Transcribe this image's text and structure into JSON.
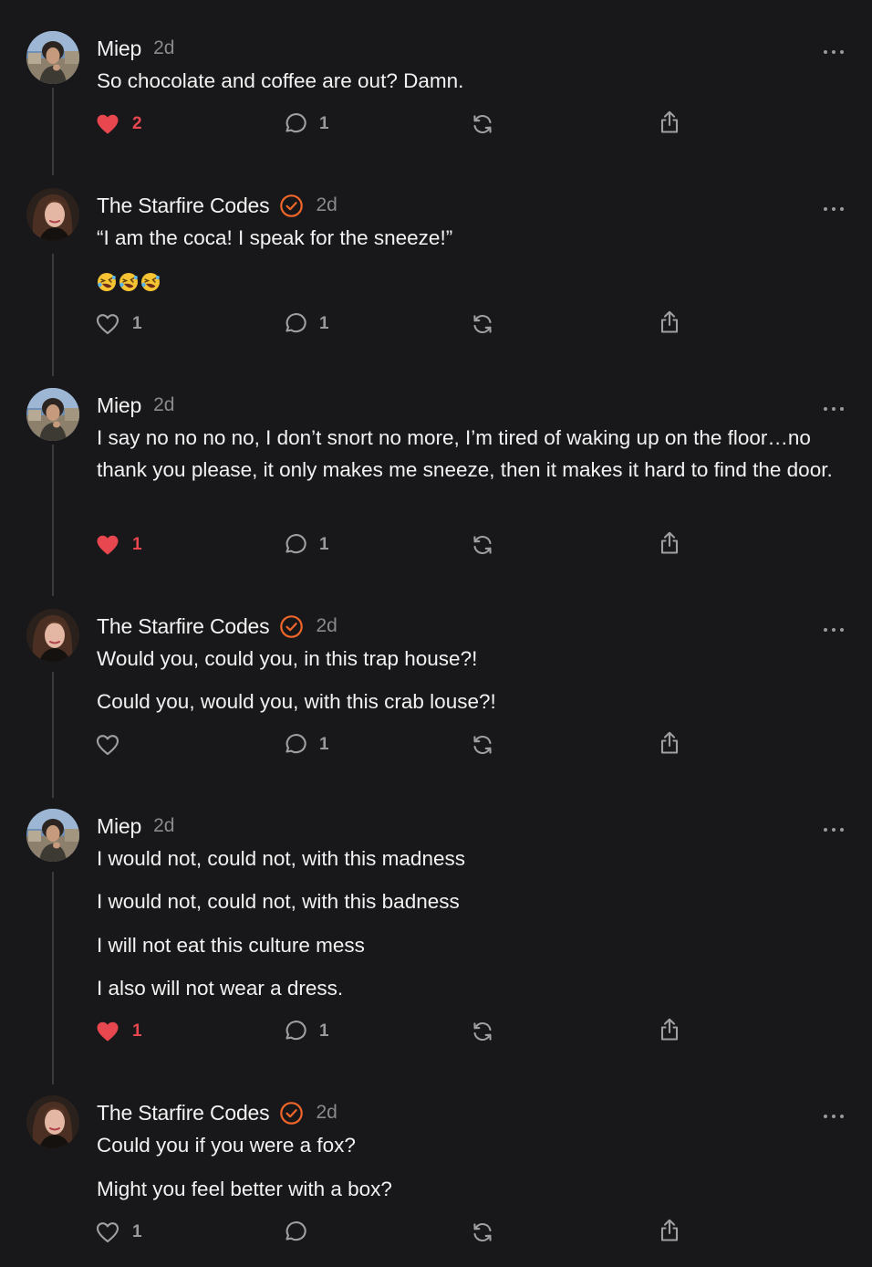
{
  "colors": {
    "background": "#18181a",
    "text": "#f2f2f2",
    "muted": "#8a8a8e",
    "like_active": "#e8474f",
    "verified_badge": "#f0662a",
    "thread_line": "#3a3a3e"
  },
  "posts": [
    {
      "author": "Miep",
      "verified": false,
      "time": "2d",
      "paragraphs": [
        "So chocolate and coffee are out? Damn."
      ],
      "emoji": "",
      "likes": "2",
      "liked": true,
      "comments": "1"
    },
    {
      "author": "The Starfire Codes",
      "verified": true,
      "time": "2d",
      "paragraphs": [
        "“I am the coca! I speak for the sneeze!”"
      ],
      "emoji": "🤣🤣🤣",
      "likes": "1",
      "liked": false,
      "comments": "1"
    },
    {
      "author": "Miep",
      "verified": false,
      "time": "2d",
      "paragraphs": [
        "I say no no no no, I don’t snort no more, I’m tired of waking up on the floor…no thank you please, it only makes me sneeze, then it makes it hard to find the door."
      ],
      "emoji": "",
      "likes": "1",
      "liked": true,
      "comments": "1"
    },
    {
      "author": "The Starfire Codes",
      "verified": true,
      "time": "2d",
      "paragraphs": [
        "Would you, could you, in this trap house?!",
        "Could you, would you, with this crab louse?!"
      ],
      "emoji": "",
      "likes": "",
      "liked": false,
      "comments": "1"
    },
    {
      "author": "Miep",
      "verified": false,
      "time": "2d",
      "paragraphs": [
        "I would not, could not, with this madness",
        "I would not, could not, with this badness",
        "I will not eat this culture mess",
        "I also will not wear a dress."
      ],
      "emoji": "",
      "likes": "1",
      "liked": true,
      "comments": "1"
    },
    {
      "author": "The Starfire Codes",
      "verified": true,
      "time": "2d",
      "paragraphs": [
        "Could you if you were a fox?",
        "Might you feel better with a box?"
      ],
      "emoji": "",
      "likes": "1",
      "liked": false,
      "comments": ""
    }
  ]
}
